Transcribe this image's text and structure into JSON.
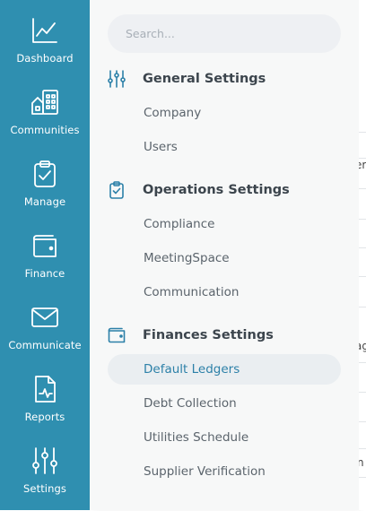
{
  "rail": {
    "items": [
      {
        "label": "Dashboard",
        "icon": "chart-line-icon"
      },
      {
        "label": "Communities",
        "icon": "buildings-icon"
      },
      {
        "label": "Manage",
        "icon": "clipboard-check-icon"
      },
      {
        "label": "Finance",
        "icon": "wallet-icon"
      },
      {
        "label": "Communicate",
        "icon": "envelope-icon"
      },
      {
        "label": "Reports",
        "icon": "report-document-icon"
      },
      {
        "label": "Settings",
        "icon": "sliders-icon"
      }
    ],
    "color": "#2f8fb0"
  },
  "search": {
    "placeholder": "Search..."
  },
  "sections": {
    "general": {
      "title": "General Settings",
      "items": [
        "Company",
        "Users"
      ]
    },
    "operations": {
      "title": "Operations Settings",
      "items": [
        "Compliance",
        "MeetingSpace",
        "Communication"
      ]
    },
    "finances": {
      "title": "Finances Settings",
      "items": [
        "Default Ledgers",
        "Debt Collection",
        "Utilities Schedule",
        "Supplier Verification"
      ],
      "active": "Default Ledgers"
    }
  },
  "background": {
    "fragments": [
      "er",
      "ag",
      "n"
    ]
  },
  "colors": {
    "accent": "#2c80a8",
    "active_bg": "#eaeef1"
  }
}
